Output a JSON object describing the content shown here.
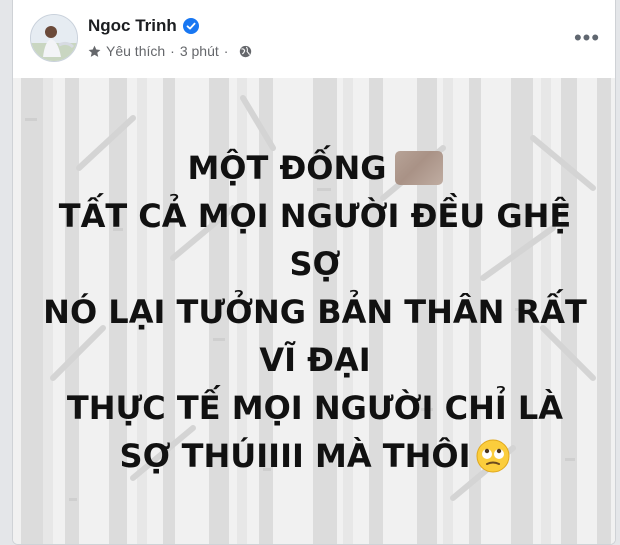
{
  "post": {
    "author_name": "Ngoc Trinh",
    "audience_label": "Yêu thích",
    "separator": "·",
    "timestamp": "3 phút",
    "more_label": "•••",
    "text_lines": [
      "MỘT ĐỐNG",
      "TẤT CẢ MỌI NGƯỜI ĐỀU GHỆ",
      "SỢ",
      "NÓ LẠI TƯỞNG BẢN THÂN RẤT",
      "VĨ ĐẠI",
      "THỰC TẾ MỌI NGƯỜI CHỈ LÀ",
      "SỢ THÚIIII MÀ THÔI"
    ]
  },
  "icons": {
    "verified": "verified-badge-icon",
    "favorite": "star-icon",
    "privacy": "globe-icon",
    "more": "more-options-icon",
    "emoji": "rolling-eyes-emoji-icon",
    "censored": "blurred-emoji"
  },
  "colors": {
    "verified_blue": "#1877f2",
    "meta_gray": "#65676b",
    "text_dark": "#111111"
  }
}
